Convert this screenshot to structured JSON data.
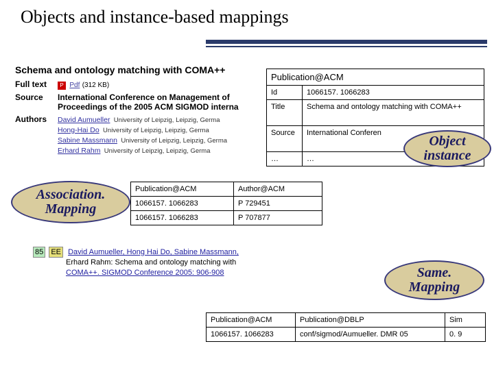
{
  "title": "Objects and instance-based mappings",
  "citation": {
    "title": "Schema and ontology matching with COMA++",
    "full_text_label": "Full text",
    "pdf_label": "Pdf",
    "pdf_size": "(312 KB)",
    "source_label": "Source",
    "source_line1": "International Conference on Management of",
    "source_line2": "Proceedings of the 2005 ACM SIGMOD interna",
    "authors_label": "Authors",
    "authors": [
      {
        "name": "David Aumueller",
        "affil": "University of Leipzig, Leipzig, Germa"
      },
      {
        "name": "Hong-Hai Do",
        "affil": "University of Leipzig, Leipzig, Germa"
      },
      {
        "name": "Sabine Massmann",
        "affil": "University of Leipzig, Leipzig, Germa"
      },
      {
        "name": "Erhard Rahm",
        "affil": "University of Leipzig, Leipzig, Germa"
      }
    ]
  },
  "pubacm": {
    "header": "Publication@ACM",
    "rows": [
      {
        "k": "Id",
        "v": "1066157. 1066283"
      },
      {
        "k": "Title",
        "v": "Schema and ontology matching with COMA++"
      },
      {
        "k": "Source",
        "v": "International Conferen"
      },
      {
        "k": "…",
        "v": "…"
      }
    ]
  },
  "assoc": {
    "header_c1": "Publication@ACM",
    "header_c2": "Author@ACM",
    "rows": [
      {
        "c1": "1066157. 1066283",
        "c2": "P 729451"
      },
      {
        "c1": "1066157. 1066283",
        "c2": "P 707877"
      }
    ]
  },
  "dblp": {
    "index": "85",
    "ee": "EE",
    "text1": "David Aumueller, Hong Hai Do, Sabine Massmann,",
    "text2": "Erhard Rahm: Schema and ontology matching with",
    "text3": "COMA++. SIGMOD Conference 2005: 906-908"
  },
  "same": {
    "h1": "Publication@ACM",
    "h2": "Publication@DBLP",
    "h3": "Sim",
    "r1c1": "1066157. 1066283",
    "r1c2": "conf/sigmod/Aumueller. DMR 05",
    "r1c3": "0. 9"
  },
  "labels": {
    "assoc1": "Association.",
    "assoc2": "Mapping",
    "obj1": "Object",
    "obj2": "instance",
    "same1": "Same.",
    "same2": "Mapping"
  }
}
